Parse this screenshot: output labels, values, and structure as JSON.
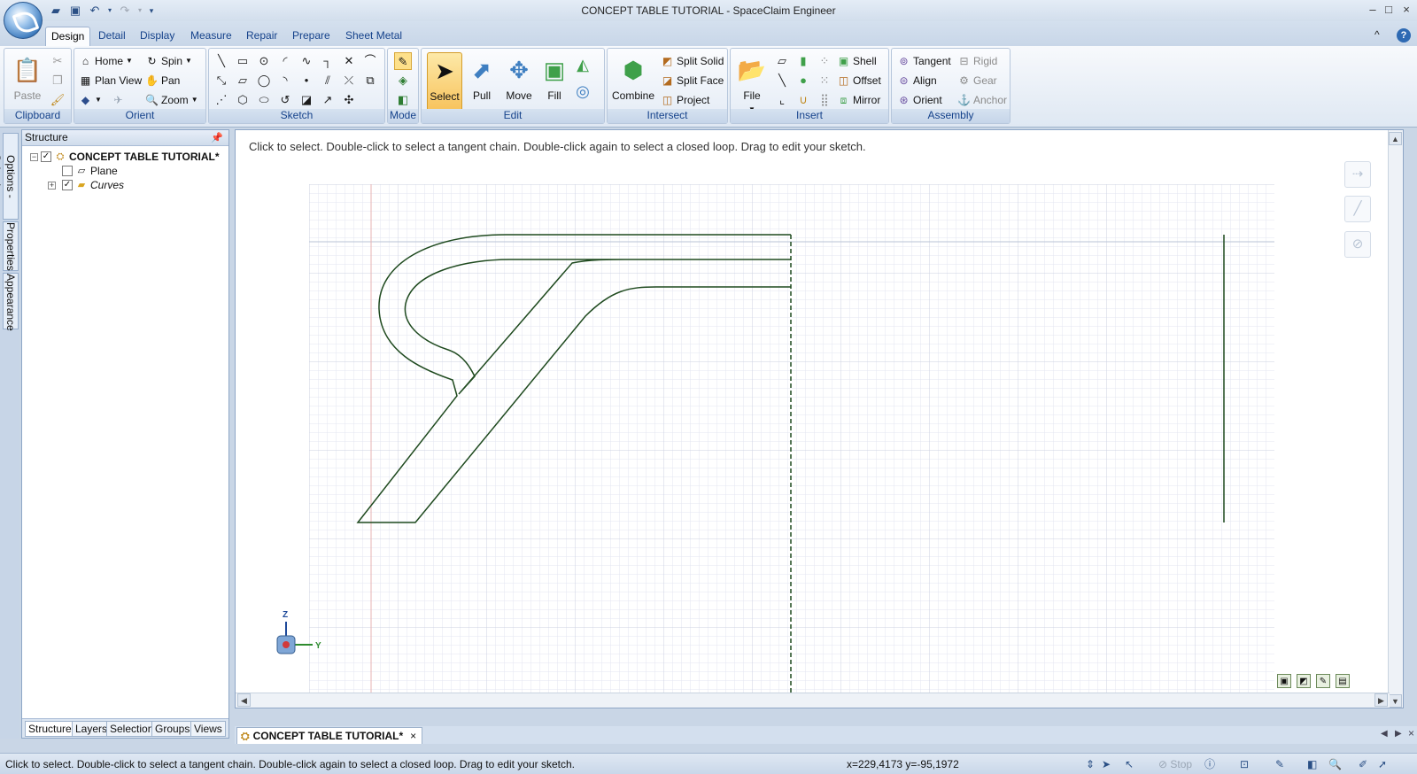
{
  "window": {
    "title": "CONCEPT TABLE TUTORIAL - SpaceClaim Engineer",
    "minimize": "–",
    "maximize": "□",
    "close": "×"
  },
  "ribbon_tabs": [
    "Design",
    "Detail",
    "Display",
    "Measure",
    "Repair",
    "Prepare",
    "Sheet Metal"
  ],
  "ribbon_collapse": "^",
  "help": "?",
  "groups": {
    "clipboard": {
      "label": "Clipboard",
      "paste": "Paste"
    },
    "orient": {
      "label": "Orient",
      "home": "Home",
      "spin": "Spin",
      "plan_view": "Plan View",
      "pan": "Pan",
      "zoom": "Zoom"
    },
    "sketch": {
      "label": "Sketch"
    },
    "mode": {
      "label": "Mode"
    },
    "edit": {
      "label": "Edit",
      "select": "Select",
      "pull": "Pull",
      "move": "Move",
      "fill": "Fill"
    },
    "intersect": {
      "label": "Intersect",
      "combine": "Combine",
      "split_solid": "Split Solid",
      "split_face": "Split Face",
      "project": "Project"
    },
    "insert": {
      "label": "Insert",
      "file": "File",
      "shell": "Shell",
      "offset": "Offset",
      "mirror": "Mirror"
    },
    "assembly": {
      "label": "Assembly",
      "tangent": "Tangent",
      "align": "Align",
      "orient": "Orient",
      "rigid": "Rigid",
      "gear": "Gear",
      "anchor": "Anchor"
    }
  },
  "side_tabs": [
    "Options - Selection",
    "Properties",
    "Appearance"
  ],
  "structure": {
    "header": "Structure",
    "root": "CONCEPT TABLE TUTORIAL*",
    "children": [
      "Plane",
      "Curves"
    ],
    "panel_tabs": [
      "Structure",
      "Layers",
      "Selection",
      "Groups",
      "Views"
    ]
  },
  "viewport": {
    "hint": "Click to select. Double-click to select a tangent chain. Double-click again to select a closed loop. Drag to edit your sketch.",
    "axis_z": "Z",
    "axis_y": "Y"
  },
  "doc_tab": {
    "label": "CONCEPT TABLE TUTORIAL*",
    "close": "×"
  },
  "status": {
    "text": "Click to select. Double-click to select a tangent chain. Double-click again to select a closed loop. Drag to edit your sketch.",
    "coords": "x=229,4173  y=-95,1972",
    "stop": "Stop"
  },
  "colors": {
    "sketch_line": "#1f4a1f",
    "grid_minor": "#e3e6f0",
    "grid_major": "#c9cfe0",
    "accent": "#15428b"
  }
}
